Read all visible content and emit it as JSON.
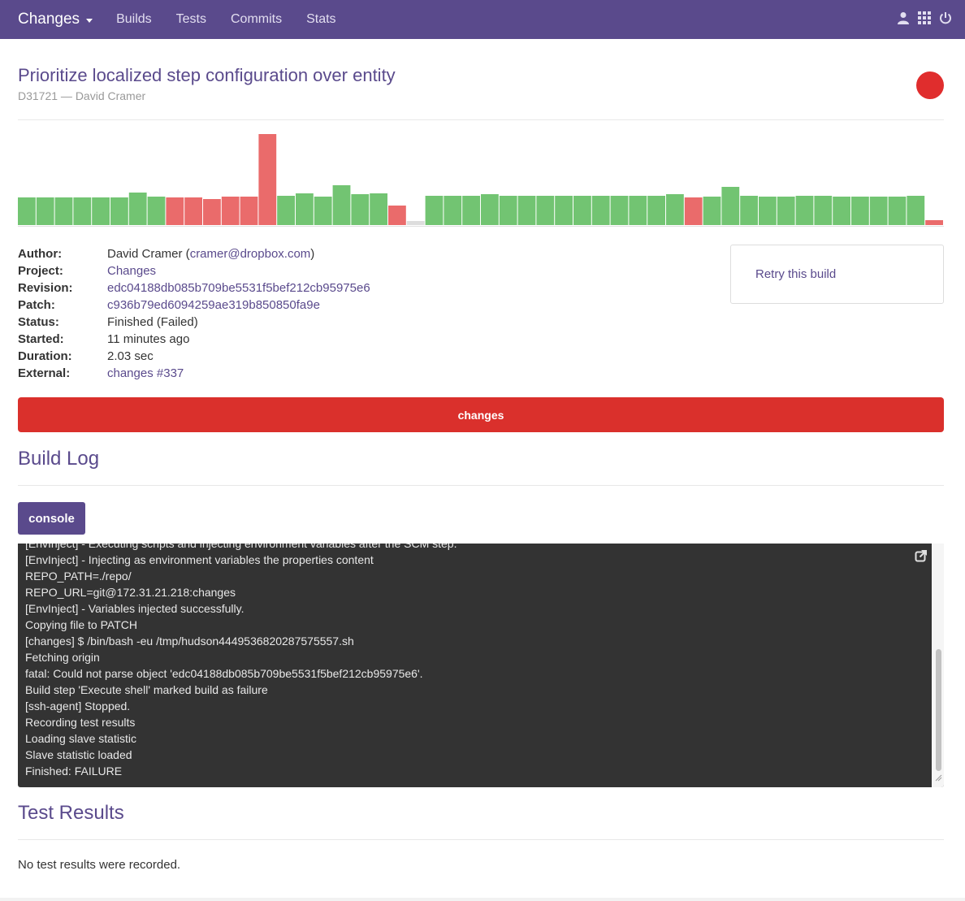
{
  "navbar": {
    "brand": "Changes",
    "links": [
      "Builds",
      "Tests",
      "Commits",
      "Stats"
    ],
    "icons": [
      "user-icon",
      "grid-icon",
      "power-icon"
    ]
  },
  "build": {
    "title": "Prioritize localized step configuration over entity",
    "subtitle": "D31721 — David Cramer",
    "status_color": "#e02d2d"
  },
  "history": {
    "colors": {
      "passed": "#72c472",
      "failed": "#ea6b6b",
      "unknown": "#dddddd"
    },
    "bars": [
      {
        "h": 34,
        "s": "passed"
      },
      {
        "h": 34,
        "s": "passed"
      },
      {
        "h": 34,
        "s": "passed"
      },
      {
        "h": 34,
        "s": "passed"
      },
      {
        "h": 34,
        "s": "passed"
      },
      {
        "h": 34,
        "s": "passed"
      },
      {
        "h": 40,
        "s": "passed"
      },
      {
        "h": 35,
        "s": "passed"
      },
      {
        "h": 34,
        "s": "failed"
      },
      {
        "h": 34,
        "s": "failed"
      },
      {
        "h": 32,
        "s": "failed"
      },
      {
        "h": 35,
        "s": "failed"
      },
      {
        "h": 35,
        "s": "failed"
      },
      {
        "h": 112,
        "s": "failed"
      },
      {
        "h": 36,
        "s": "passed"
      },
      {
        "h": 39,
        "s": "passed"
      },
      {
        "h": 35,
        "s": "passed"
      },
      {
        "h": 49,
        "s": "passed"
      },
      {
        "h": 38,
        "s": "passed"
      },
      {
        "h": 39,
        "s": "passed"
      },
      {
        "h": 24,
        "s": "failed"
      },
      {
        "h": 5,
        "s": "unknown"
      },
      {
        "h": 36,
        "s": "passed"
      },
      {
        "h": 36,
        "s": "passed"
      },
      {
        "h": 36,
        "s": "passed"
      },
      {
        "h": 38,
        "s": "passed"
      },
      {
        "h": 36,
        "s": "passed"
      },
      {
        "h": 36,
        "s": "passed"
      },
      {
        "h": 36,
        "s": "passed"
      },
      {
        "h": 36,
        "s": "passed"
      },
      {
        "h": 36,
        "s": "passed"
      },
      {
        "h": 36,
        "s": "passed"
      },
      {
        "h": 36,
        "s": "passed"
      },
      {
        "h": 36,
        "s": "passed"
      },
      {
        "h": 36,
        "s": "passed"
      },
      {
        "h": 38,
        "s": "passed"
      },
      {
        "h": 34,
        "s": "failed"
      },
      {
        "h": 35,
        "s": "passed"
      },
      {
        "h": 47,
        "s": "passed"
      },
      {
        "h": 36,
        "s": "passed"
      },
      {
        "h": 35,
        "s": "passed"
      },
      {
        "h": 35,
        "s": "passed"
      },
      {
        "h": 36,
        "s": "passed"
      },
      {
        "h": 36,
        "s": "passed"
      },
      {
        "h": 35,
        "s": "passed"
      },
      {
        "h": 35,
        "s": "passed"
      },
      {
        "h": 35,
        "s": "passed"
      },
      {
        "h": 35,
        "s": "passed"
      },
      {
        "h": 36,
        "s": "passed"
      },
      {
        "h": 6,
        "s": "failed"
      }
    ]
  },
  "details": [
    {
      "label": "Author:",
      "value": "David Cramer (",
      "link": "cramer@dropbox.com",
      "suffix": ")"
    },
    {
      "label": "Project:",
      "value": "",
      "link": "Changes",
      "suffix": ""
    },
    {
      "label": "Revision:",
      "value": "",
      "link": "edc04188db085b709be5531f5bef212cb95975e6",
      "suffix": ""
    },
    {
      "label": "Patch:",
      "value": "",
      "link": "c936b79ed6094259ae319b850850fa9e",
      "suffix": ""
    },
    {
      "label": "Status:",
      "value": "Finished (Failed)",
      "link": "",
      "suffix": ""
    },
    {
      "label": "Started:",
      "value": "11 minutes ago",
      "link": "",
      "suffix": ""
    },
    {
      "label": "Duration:",
      "value": "2.03 sec",
      "link": "",
      "suffix": ""
    },
    {
      "label": "External:",
      "value": "",
      "link": "changes #337",
      "suffix": ""
    }
  ],
  "retry_label": "Retry this build",
  "phase_label": "changes",
  "build_log": {
    "heading": "Build Log",
    "tab_label": "console",
    "lines": [
      "[EnvInject] - Executing scripts and injecting environment variables after the SCM step.",
      "[EnvInject] - Injecting as environment variables the properties content",
      "REPO_PATH=./repo/",
      "REPO_URL=git@172.31.21.218:changes",
      "[EnvInject] - Variables injected successfully.",
      "Copying file to PATCH",
      "[changes] $ /bin/bash -eu /tmp/hudson4449536820287575557.sh",
      "Fetching origin",
      "fatal: Could not parse object 'edc04188db085b709be5531f5bef212cb95975e6'.",
      "Build step 'Execute shell' marked build as failure",
      "[ssh-agent] Stopped.",
      "Recording test results",
      "Loading slave statistic",
      "Slave statistic loaded",
      "Finished: FAILURE"
    ]
  },
  "test_results": {
    "heading": "Test Results",
    "empty_text": "No test results were recorded."
  }
}
